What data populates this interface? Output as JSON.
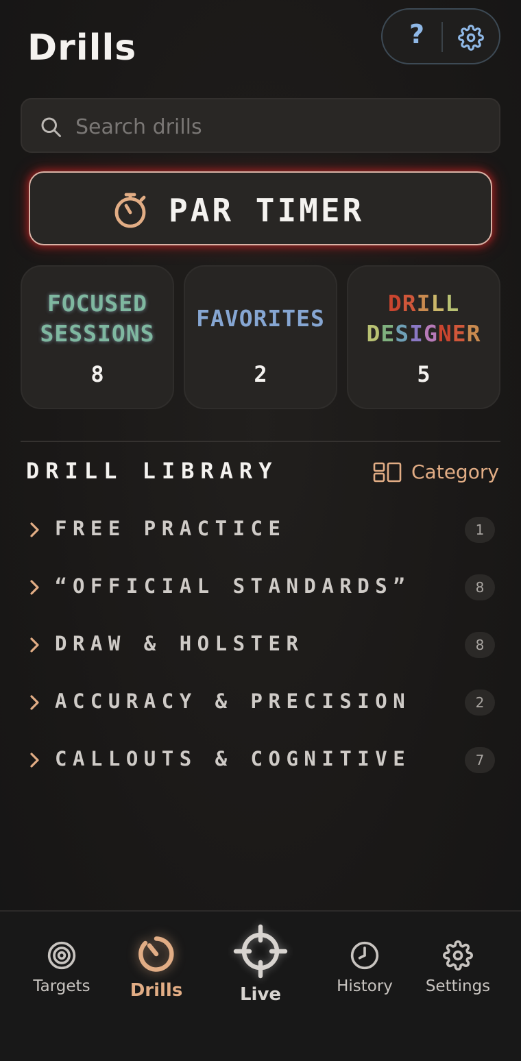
{
  "header": {
    "title": "Drills",
    "help_label": "?",
    "help_icon": "help-icon",
    "settings_icon": "gear-icon"
  },
  "search": {
    "placeholder": "Search drills",
    "icon": "search-icon"
  },
  "par_timer": {
    "label": "PAR TIMER",
    "icon": "stopwatch-icon"
  },
  "cards": [
    {
      "line1": "FOCUSED",
      "line2": "SESSIONS",
      "count": "8"
    },
    {
      "line1": "FAVORITES",
      "count": "2"
    },
    {
      "line1": "DRILL",
      "line2": "DESIGNER",
      "count": "5"
    }
  ],
  "library": {
    "title": "DRILL LIBRARY",
    "category_label": "Category",
    "category_icon": "layout-icon",
    "categories": [
      {
        "name": "FREE PRACTICE",
        "count": "1"
      },
      {
        "name": "“OFFICIAL STANDARDS”",
        "count": "8"
      },
      {
        "name": "DRAW & HOLSTER",
        "count": "8"
      },
      {
        "name": "ACCURACY & PRECISION",
        "count": "2"
      },
      {
        "name": "CALLOUTS & COGNITIVE",
        "count": "7"
      }
    ]
  },
  "tabs": [
    {
      "label": "Targets",
      "icon": "target-icon"
    },
    {
      "label": "Drills",
      "icon": "timer-icon",
      "active": true
    },
    {
      "label": "Live",
      "icon": "crosshair-icon"
    },
    {
      "label": "History",
      "icon": "clock-icon"
    },
    {
      "label": "Settings",
      "icon": "gear-icon"
    }
  ],
  "colors": {
    "accent": "#e2ad85",
    "background": "#1c1a19",
    "focused": "#7fb8a0",
    "favorites": "#86a6d2",
    "help_blue": "#8fb8e6",
    "par_glow": "#d22828"
  }
}
